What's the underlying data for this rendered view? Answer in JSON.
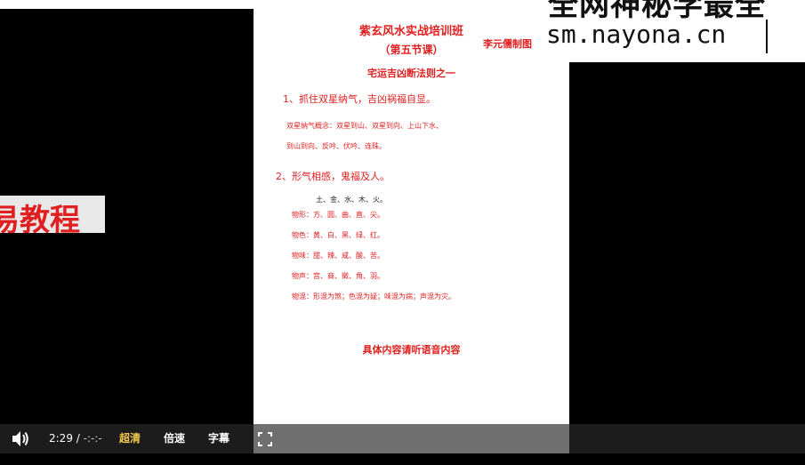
{
  "slide": {
    "title": "紫玄风水实战培训班",
    "lesson": "（第五节课）",
    "author": "李元儒制图",
    "section": "宅运吉凶断法则之一",
    "point1": "1、抓住双星纳气，吉凶祸福自显。",
    "point1_line1": "双星纳气概念：双星到山、双星到向、上山下水、",
    "point1_line2": "到山到向、反吟、伏吟、连珠。",
    "point2": "2、形气相感，鬼福及人。",
    "wuxing": "土、金、水、木、火。",
    "rows": [
      {
        "label": "物形：",
        "value": "方、圆、曲、直、尖。"
      },
      {
        "label": "物色：",
        "value": "黄、白、黑、绿、红。"
      },
      {
        "label": "物味：",
        "value": "甜、辣、咸、酸、苦。"
      },
      {
        "label": "物声：",
        "value": "宫、商、徵、角、羽。"
      },
      {
        "label": "物混：",
        "value": "形混为煞；色混为疑；味混为病；声混为灾。"
      }
    ],
    "bottom": "具体内容请听语音内容"
  },
  "watermark": {
    "line1": "全网神秘学最全",
    "line2": "sm.nayona.cn"
  },
  "left_badge": "易教程",
  "player": {
    "current_time": "2:29",
    "separator": "/",
    "duration": "-:-:-",
    "quality": "超清",
    "speed": "倍速",
    "subtitle": "字幕",
    "icons": {
      "volume": "volume-icon",
      "fullscreen": "fullscreen-icon"
    },
    "colors": {
      "quality_active": "#f2c94c"
    }
  }
}
